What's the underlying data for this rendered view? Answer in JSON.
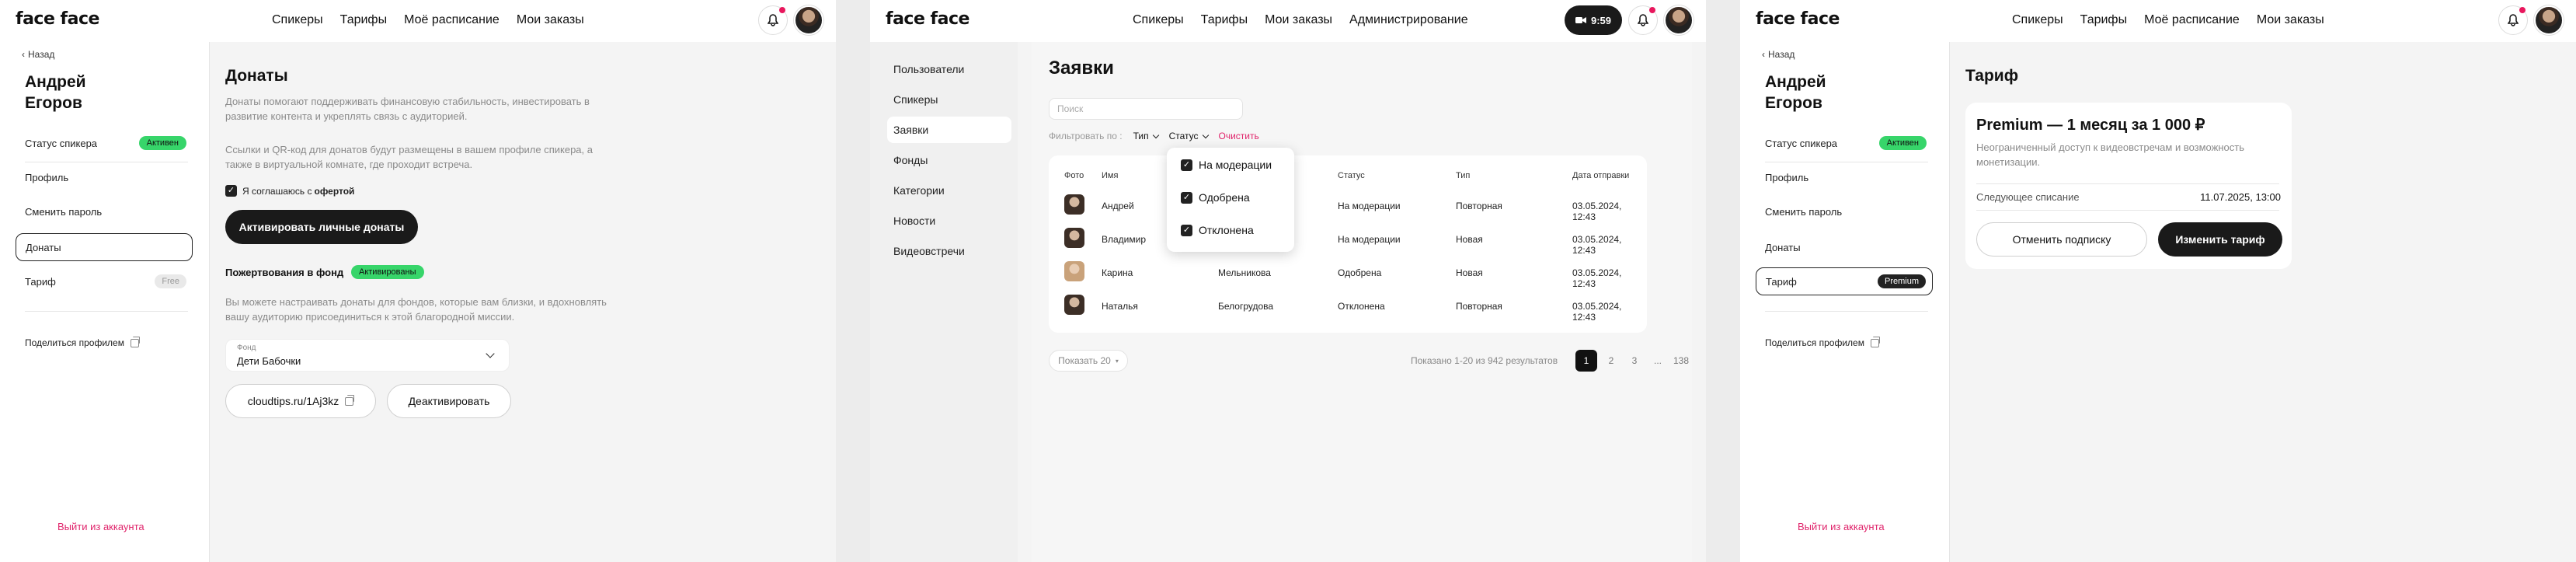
{
  "brand": {
    "logo": "face face"
  },
  "p1": {
    "nav": [
      "Спикеры",
      "Тарифы",
      "Моё расписание",
      "Мои заказы"
    ],
    "back": "Назад",
    "user_name": "Андрей Егоров",
    "sidebar": [
      {
        "label": "Статус спикера",
        "badge": "Активен"
      },
      {
        "label": "Профиль"
      },
      {
        "label": "Сменить пароль"
      },
      {
        "label": "Донаты"
      },
      {
        "label": "Тариф",
        "badge": "Free"
      }
    ],
    "share": "Поделиться профилем",
    "logout": "Выйти из аккаунта",
    "title": "Донаты",
    "desc1": "Донаты помогают поддерживать финансовую стабильность, инвестировать в развитие контента и укреплять связь с аудиторией.",
    "desc2": "Ссылки и QR-код для донатов будут размещены в вашем профиле спикера, а также в виртуальной комнате, где проходит встреча.",
    "agree_prefix": "Я соглашаюсь с ",
    "agree_link": "офертой",
    "activate_btn": "Активировать личные донаты",
    "fund_title": "Пожертвования в фонд",
    "fund_badge": "Активированы",
    "fund_desc": "Вы можете настраивать донаты для фондов, которые вам близки, и вдохновлять вашу аудиторию присоединиться к этой благородной миссии.",
    "fund_label": "Фонд",
    "fund_value": "Дети Бабочки",
    "link": "cloudtips.ru/1Aj3kz",
    "deactivate": "Деактивировать"
  },
  "p2": {
    "nav": [
      "Спикеры",
      "Тарифы",
      "Мои заказы",
      "Администрирование"
    ],
    "rec_time": "9:59",
    "menu": [
      "Пользователи",
      "Спикеры",
      "Заявки",
      "Фонды",
      "Категории",
      "Новости",
      "Видеовстречи"
    ],
    "title": "Заявки",
    "search_placeholder": "Поиск",
    "filter_label": "Фильтровать по :",
    "filter_type": "Тип",
    "filter_status": "Статус",
    "clear": "Очистить",
    "columns": [
      "Фото",
      "Имя",
      "",
      "Статус",
      "Тип",
      "Дата отправки"
    ],
    "rows": [
      {
        "name": "Андрей",
        "surname": "",
        "status": "На модерации",
        "type": "Повторная",
        "date": "03.05.2024, 12:43"
      },
      {
        "name": "Владимир",
        "surname": "",
        "status": "На модерации",
        "type": "Новая",
        "date": "03.05.2024, 12:43"
      },
      {
        "name": "Карина",
        "surname": "Мельникова",
        "status": "Одобрена",
        "type": "Новая",
        "date": "03.05.2024, 12:43"
      },
      {
        "name": "Наталья",
        "surname": "Белогрудова",
        "status": "Отклонена",
        "type": "Повторная",
        "date": "03.05.2024, 12:43"
      }
    ],
    "status_options": [
      "На модерации",
      "Одобрена",
      "Отклонена"
    ],
    "show": "Показать 20",
    "shown": "Показано 1-20 из 942 результатов",
    "pages": [
      "1",
      "2",
      "3",
      "...",
      "138"
    ]
  },
  "p3": {
    "nav": [
      "Спикеры",
      "Тарифы",
      "Моё расписание",
      "Мои заказы"
    ],
    "back": "Назад",
    "user_name": "Андрей Егоров",
    "sidebar": [
      {
        "label": "Статус спикера",
        "badge": "Активен"
      },
      {
        "label": "Профиль"
      },
      {
        "label": "Сменить пароль"
      },
      {
        "label": "Донаты"
      },
      {
        "label": "Тариф",
        "badge": "Premium"
      }
    ],
    "share": "Поделиться профилем",
    "logout": "Выйти из аккаунта",
    "title": "Тариф",
    "plan": "Premium — 1 месяц за 1 000 ₽",
    "plan_desc": "Неограниченный доступ к видеовстречам и возможность монетизации.",
    "next_label": "Следующее списание",
    "next_value": "11.07.2025, 13:00",
    "cancel": "Отменить подписку",
    "change": "Изменить тариф"
  },
  "colors": {
    "accent": "#37d56a",
    "pink": "#e0246b",
    "dark": "#1a1a1a"
  }
}
